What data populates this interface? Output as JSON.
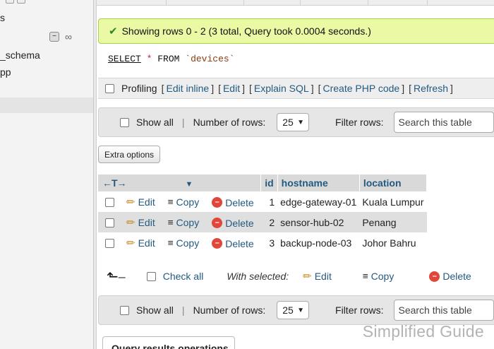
{
  "nav": {
    "fragment_top": "s",
    "fragment_schema": "_schema",
    "fragment_app": "pp",
    "collapse_glyph": "−",
    "link_glyph": "∞"
  },
  "status": {
    "icon": "checkmark-icon",
    "message": "Showing rows 0 - 2 (3 total, Query took 0.0004 seconds.)",
    "color": "#ebf8a4"
  },
  "sql": {
    "select": "SELECT",
    "star": "*",
    "from": "FROM",
    "table": "`devices`"
  },
  "profiling": {
    "label": "Profiling",
    "links": [
      "Edit inline",
      "Edit",
      "Explain SQL",
      "Create PHP code",
      "Refresh"
    ]
  },
  "nav_bar": {
    "show_all": "Show all",
    "separator": "|",
    "rows_label": "Number of rows:",
    "rows_value": "25",
    "filter_label": "Filter rows:",
    "search_placeholder": "Search this table"
  },
  "extra_options": "Extra options",
  "table": {
    "arrows": "←T→",
    "columns": [
      "id",
      "hostname",
      "location"
    ],
    "actions": {
      "edit": "Edit",
      "copy": "Copy",
      "delete": "Delete"
    },
    "rows": [
      {
        "id": "1",
        "hostname": "edge-gateway-01",
        "location": "Kuala Lumpur"
      },
      {
        "id": "2",
        "hostname": "sensor-hub-02",
        "location": "Penang"
      },
      {
        "id": "3",
        "hostname": "backup-node-03",
        "location": "Johor Bahru"
      }
    ]
  },
  "bulk": {
    "check_all": "Check all",
    "with_selected": "With selected:",
    "edit": "Edit",
    "copy": "Copy",
    "delete": "Delete"
  },
  "query_results_operations": "Query results operations",
  "watermark": "Simplified Guide",
  "colors": {
    "link": "#235a81",
    "header_bg": "#d9d9d9",
    "success_border": "#a2d246"
  }
}
